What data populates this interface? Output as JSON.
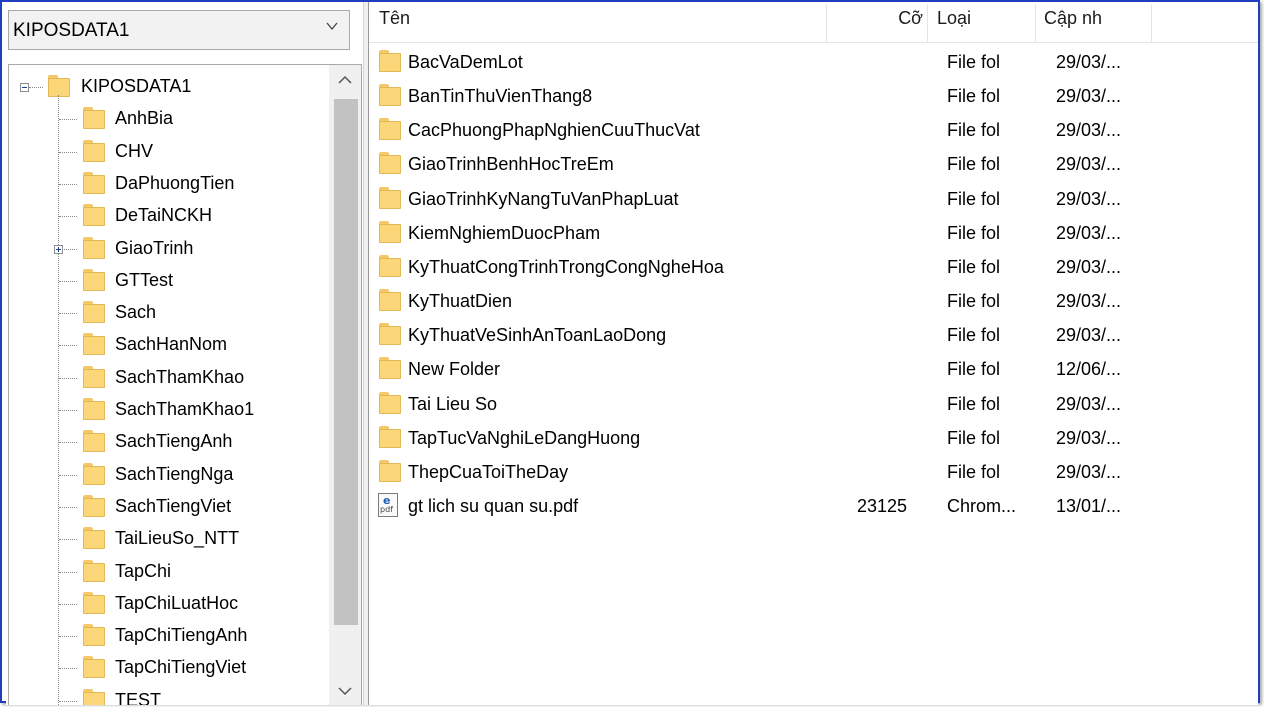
{
  "combo": {
    "value": "KIPOSDATA1"
  },
  "tree": {
    "root": "KIPOSDATA1",
    "items": [
      {
        "label": "AnhBia",
        "expandable": false
      },
      {
        "label": "CHV",
        "expandable": false
      },
      {
        "label": "DaPhuongTien",
        "expandable": false
      },
      {
        "label": "DeTaiNCKH",
        "expandable": false
      },
      {
        "label": "GiaoTrinh",
        "expandable": true
      },
      {
        "label": "GTTest",
        "expandable": false
      },
      {
        "label": "Sach",
        "expandable": false
      },
      {
        "label": "SachHanNom",
        "expandable": false
      },
      {
        "label": "SachThamKhao",
        "expandable": false
      },
      {
        "label": "SachThamKhao1",
        "expandable": false
      },
      {
        "label": "SachTiengAnh",
        "expandable": false
      },
      {
        "label": "SachTiengNga",
        "expandable": false
      },
      {
        "label": "SachTiengViet",
        "expandable": false
      },
      {
        "label": "TaiLieuSo_NTT",
        "expandable": false
      },
      {
        "label": "TapChi",
        "expandable": false
      },
      {
        "label": "TapChiLuatHoc",
        "expandable": false
      },
      {
        "label": "TapChiTiengAnh",
        "expandable": false
      },
      {
        "label": "TapChiTiengViet",
        "expandable": false
      },
      {
        "label": "TEST",
        "expandable": false
      }
    ]
  },
  "list": {
    "headers": {
      "name": "Tên",
      "size": "Cỡ",
      "type": "Loại",
      "modified": "Cập nh"
    },
    "rows": [
      {
        "icon": "folder-icon",
        "name": "BacVaDemLot",
        "size": "",
        "type": "File fol",
        "modified": "29/03/..."
      },
      {
        "icon": "folder-icon",
        "name": "BanTinThuVienThang8",
        "size": "",
        "type": "File fol",
        "modified": "29/03/..."
      },
      {
        "icon": "folder-icon",
        "name": "CacPhuongPhapNghienCuuThucVat",
        "size": "",
        "type": "File fol",
        "modified": "29/03/..."
      },
      {
        "icon": "folder-icon",
        "name": "GiaoTrinhBenhHocTreEm",
        "size": "",
        "type": "File fol",
        "modified": "29/03/..."
      },
      {
        "icon": "folder-icon",
        "name": "GiaoTrinhKyNangTuVanPhapLuat",
        "size": "",
        "type": "File fol",
        "modified": "29/03/..."
      },
      {
        "icon": "folder-icon",
        "name": "KiemNghiemDuocPham",
        "size": "",
        "type": "File fol",
        "modified": "29/03/..."
      },
      {
        "icon": "folder-icon",
        "name": "KyThuatCongTrinhTrongCongNgheHoa",
        "size": "",
        "type": "File fol",
        "modified": "29/03/..."
      },
      {
        "icon": "folder-icon",
        "name": "KyThuatDien",
        "size": "",
        "type": "File fol",
        "modified": "29/03/..."
      },
      {
        "icon": "folder-icon",
        "name": "KyThuatVeSinhAnToanLaoDong",
        "size": "",
        "type": "File fol",
        "modified": "29/03/..."
      },
      {
        "icon": "folder-icon",
        "name": "New Folder",
        "size": "",
        "type": "File fol",
        "modified": "12/06/..."
      },
      {
        "icon": "folder-icon",
        "name": "Tai Lieu So",
        "size": "",
        "type": "File fol",
        "modified": "29/03/..."
      },
      {
        "icon": "folder-icon",
        "name": "TapTucVaNghiLeDangHuong",
        "size": "",
        "type": "File fol",
        "modified": "29/03/..."
      },
      {
        "icon": "folder-icon",
        "name": "ThepCuaToiTheDay",
        "size": "",
        "type": "File fol",
        "modified": "29/03/..."
      },
      {
        "icon": "pdf-file-icon",
        "icon_text": "pdf",
        "name": "gt lich su quan su.pdf",
        "size": "23125",
        "type": "Chrom...",
        "modified": "13/01/..."
      }
    ]
  }
}
